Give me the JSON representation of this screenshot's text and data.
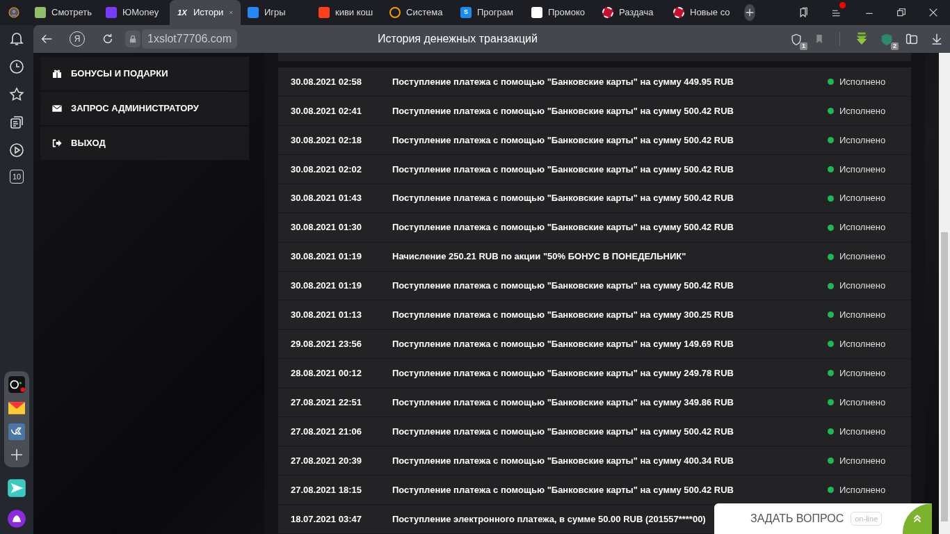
{
  "browser": {
    "tabs": [
      {
        "label": "Смотреть",
        "selected": false,
        "kind": "leaf"
      },
      {
        "label": "ЮMoney",
        "selected": false,
        "kind": "yoo"
      },
      {
        "label": "Истори",
        "selected": true,
        "kind": "onex"
      },
      {
        "label": "Игры",
        "selected": false,
        "kind": "vk"
      },
      {
        "label": "киви кош",
        "selected": false,
        "kind": "ya"
      },
      {
        "label": "Система",
        "selected": false,
        "kind": "q"
      },
      {
        "label": "Програм",
        "selected": false,
        "kind": "s"
      },
      {
        "label": "Промоко",
        "selected": false,
        "kind": "gmail"
      },
      {
        "label": "Раздача",
        "selected": false,
        "kind": "chip"
      },
      {
        "label": "Новые со",
        "selected": false,
        "kind": "chip"
      }
    ],
    "onex_logo": "1X",
    "s_logo": "S",
    "yandex_button": "Я",
    "url": "1xslot77706.com",
    "page_title": "История денежных транзакций",
    "protect_badge": "1",
    "extension_badge": "2",
    "rail_counter": "10"
  },
  "menu": [
    {
      "label": "БОНУСЫ И ПОДАРКИ",
      "kind": "gift"
    },
    {
      "label": "ЗАПРОС АДМИНИСТРАТОРУ",
      "kind": "mail"
    },
    {
      "label": "ВЫХОД",
      "kind": "exit"
    }
  ],
  "transactions": [
    {
      "date": "30.08.2021 02:58",
      "description": "Поступление платежа с помощью \"Банковские карты\" на сумму 449.95 RUB",
      "status": "Исполнено",
      "color": "#1db954"
    },
    {
      "date": "30.08.2021 02:41",
      "description": "Поступление платежа с помощью \"Банковские карты\" на сумму 500.42 RUB",
      "status": "Исполнено",
      "color": "#1db954"
    },
    {
      "date": "30.08.2021 02:18",
      "description": "Поступление платежа с помощью \"Банковские карты\" на сумму 500.42 RUB",
      "status": "Исполнено",
      "color": "#1db954"
    },
    {
      "date": "30.08.2021 02:02",
      "description": "Поступление платежа с помощью \"Банковские карты\" на сумму 500.42 RUB",
      "status": "Исполнено",
      "color": "#1db954"
    },
    {
      "date": "30.08.2021 01:43",
      "description": "Поступление платежа с помощью \"Банковские карты\" на сумму 500.42 RUB",
      "status": "Исполнено",
      "color": "#1db954"
    },
    {
      "date": "30.08.2021 01:30",
      "description": "Поступление платежа с помощью \"Банковские карты\" на сумму 500.42 RUB",
      "status": "Исполнено",
      "color": "#1db954"
    },
    {
      "date": "30.08.2021 01:19",
      "description": "Начисление 250.21 RUB по акции \"50% БОНУС В ПОНЕДЕЛЬНИК\"",
      "status": "Исполнено",
      "color": "#1db954"
    },
    {
      "date": "30.08.2021 01:19",
      "description": "Поступление платежа с помощью \"Банковские карты\" на сумму 500.42 RUB",
      "status": "Исполнено",
      "color": "#1db954"
    },
    {
      "date": "30.08.2021 01:13",
      "description": "Поступление платежа с помощью \"Банковские карты\" на сумму 300.25 RUB",
      "status": "Исполнено",
      "color": "#1db954"
    },
    {
      "date": "29.08.2021 23:56",
      "description": "Поступление платежа с помощью \"Банковские карты\" на сумму 149.69 RUB",
      "status": "Исполнено",
      "color": "#1db954"
    },
    {
      "date": "28.08.2021 00:12",
      "description": "Поступление платежа с помощью \"Банковские карты\" на сумму 249.78 RUB",
      "status": "Исполнено",
      "color": "#1db954"
    },
    {
      "date": "27.08.2021 22:51",
      "description": "Поступление платежа с помощью \"Банковские карты\" на сумму 349.86 RUB",
      "status": "Исполнено",
      "color": "#1db954"
    },
    {
      "date": "27.08.2021 21:06",
      "description": "Поступление платежа с помощью \"Банковские карты\" на сумму 500.42 RUB",
      "status": "Исполнено",
      "color": "#1db954"
    },
    {
      "date": "27.08.2021 20:39",
      "description": "Поступление платежа с помощью \"Банковские карты\" на сумму 400.34 RUB",
      "status": "Исполнено",
      "color": "#1db954"
    },
    {
      "date": "27.08.2021 18:15",
      "description": "Поступление платежа с помощью \"Банковские карты\" на сумму 500.42 RUB",
      "status": "Исполнено",
      "color": "#1db954"
    },
    {
      "date": "18.07.2021 03:47",
      "description": "Поступление электронного платежа, в сумме 50.00 RUB (201557****00)"
    }
  ],
  "chat": {
    "label": "ЗАДАТЬ ВОПРОС",
    "badge": "on-line"
  }
}
